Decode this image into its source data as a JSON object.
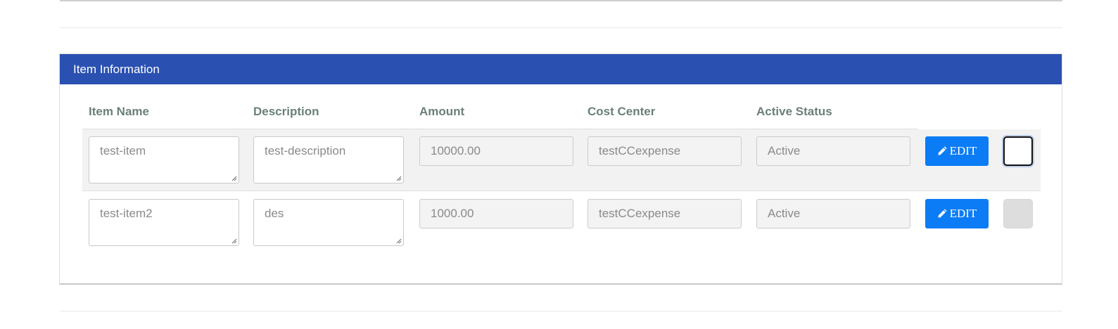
{
  "panel": {
    "title": "Item Information"
  },
  "columns": {
    "item_name": "Item Name",
    "description": "Description",
    "amount": "Amount",
    "cost_center": "Cost Center",
    "active_status": "Active Status"
  },
  "rows": [
    {
      "item_name": "test-item",
      "description": "test-description",
      "amount": "10000.00",
      "cost_center": "testCCexpense",
      "active_status": "Active",
      "edit_label": "EDIT",
      "select_focused": true
    },
    {
      "item_name": "test-item2",
      "description": "des",
      "amount": "1000.00",
      "cost_center": "testCCexpense",
      "active_status": "Active",
      "edit_label": "EDIT",
      "select_focused": false
    }
  ],
  "icons": {
    "edit": "pencil-icon",
    "resize": "resize-handle-icon"
  },
  "colors": {
    "header_bg": "#2a50b1",
    "edit_button": "#0b7cf5",
    "column_header_text": "#6b7f78"
  }
}
